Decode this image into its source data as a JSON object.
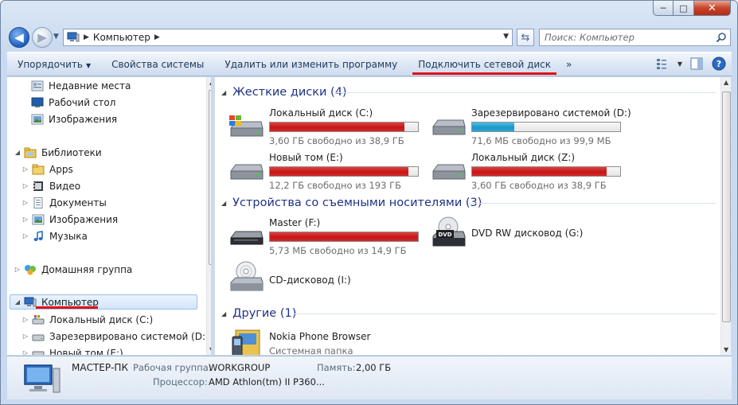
{
  "window": {
    "minimize_glyph": "─",
    "maximize_glyph": "□",
    "close_glyph": "✕"
  },
  "nav": {
    "back_glyph": "◀",
    "forward_glyph": "▶",
    "address_path": "Компьютер",
    "search_placeholder": "Поиск: Компьютер"
  },
  "toolbar": {
    "items": [
      {
        "label": "Упорядочить",
        "has_caret": true
      },
      {
        "label": "Свойства системы"
      },
      {
        "label": "Удалить или изменить программу"
      },
      {
        "label": "Подключить сетевой диск",
        "highlighted": true
      }
    ],
    "more": "»"
  },
  "sidebar": {
    "items": [
      {
        "label": "Недавние места",
        "icon": "recent-places-icon"
      },
      {
        "label": "Рабочий стол",
        "icon": "desktop-icon"
      },
      {
        "label": "Изображения",
        "icon": "pictures-icon"
      },
      {
        "label": "Библиотеки",
        "icon": "libraries-icon",
        "expanded": true
      },
      {
        "label": "Apps",
        "icon": "folder-icon"
      },
      {
        "label": "Видео",
        "icon": "video-icon"
      },
      {
        "label": "Документы",
        "icon": "documents-icon"
      },
      {
        "label": "Изображения",
        "icon": "pictures-icon"
      },
      {
        "label": "Музыка",
        "icon": "music-icon"
      },
      {
        "label": "Домашняя группа",
        "icon": "homegroup-icon"
      },
      {
        "label": "Компьютер",
        "icon": "computer-icon",
        "selected": true,
        "expanded": true
      },
      {
        "label": "Локальный диск (C:)",
        "icon": "windows-drive-icon"
      },
      {
        "label": "Зарезервировано системой (D:)",
        "icon": "drive-icon"
      },
      {
        "label": "Новый том (E:)",
        "icon": "drive-icon"
      }
    ]
  },
  "groups": {
    "hard_disks": {
      "title": "Жесткие диски (4)",
      "drives": [
        {
          "name": "Локальный диск (C:)",
          "free": "3,60 ГБ свободно из 38,9 ГБ",
          "used_fraction": 0.907,
          "bar_color": "red",
          "icon": "windows-drive-icon"
        },
        {
          "name": "Зарезервировано системой (D:)",
          "free": "71,6 МБ свободно из 99,9 МБ",
          "used_fraction": 0.283,
          "bar_color": "blue",
          "icon": "hard-drive-icon"
        },
        {
          "name": "Новый том (E:)",
          "free": "12,2 ГБ свободно из 193 ГБ",
          "used_fraction": 0.937,
          "bar_color": "red",
          "icon": "hard-drive-icon"
        },
        {
          "name": "Локальный диск (Z:)",
          "free": "3,60 ГБ свободно из 38,9 ГБ",
          "used_fraction": 0.907,
          "bar_color": "red",
          "icon": "hard-drive-icon"
        }
      ]
    },
    "removable": {
      "title": "Устройства со съемными носителями (3)",
      "drives": [
        {
          "name": "Master (F:)",
          "free": "5,73 МБ свободно из 14,9 ГБ",
          "used_fraction": 0.999,
          "bar_color": "red",
          "icon": "usb-drive-icon"
        },
        {
          "name": "DVD RW дисковод (G:)",
          "icon": "dvd-drive-icon",
          "dvd_label": "DVD"
        },
        {
          "name": "CD-дисковод (I:)",
          "icon": "cd-drive-icon"
        }
      ]
    },
    "other": {
      "title": "Другие (1)",
      "items": [
        {
          "name": "Nokia Phone Browser",
          "subtitle": "Системная папка",
          "icon": "phone-browser-icon"
        }
      ]
    }
  },
  "details": {
    "computer_name": "МАСТЕР-ПК",
    "workgroup_label": "Рабочая группа:",
    "workgroup_value": "WORKGROUP",
    "memory_label": "Память:",
    "memory_value": "2,00 ГБ",
    "cpu_label": "Процессор:",
    "cpu_value": "AMD Athlon(tm) II P360..."
  },
  "colors": {
    "accent_red": "#e01010",
    "bar_red": "#c3161a",
    "bar_blue": "#1d96c8",
    "group_header": "#1e3287"
  }
}
